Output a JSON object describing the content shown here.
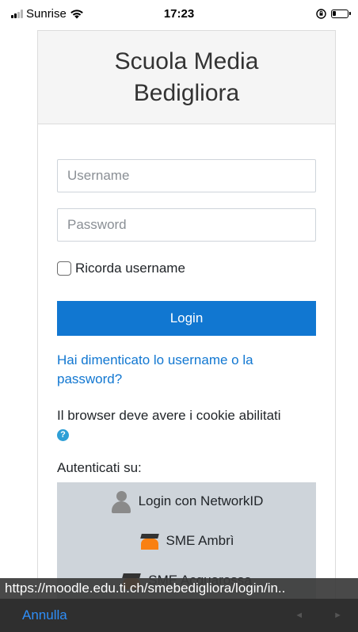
{
  "status_bar": {
    "carrier": "Sunrise",
    "time": "17:23"
  },
  "site": {
    "name": "Scuola Media Bedigliora"
  },
  "form": {
    "username_placeholder": "Username",
    "password_placeholder": "Password",
    "remember_label": "Ricorda username",
    "login_label": "Login",
    "forgot_link": "Hai dimenticato lo username o la password?",
    "cookie_notice": "Il browser deve avere i cookie abilitati",
    "auth_label": "Autenticati su:"
  },
  "auth_providers": [
    {
      "label": "Login con NetworkID",
      "icon": "user-icon"
    },
    {
      "label": "SME Ambrì",
      "icon": "moodle-icon"
    },
    {
      "label": "SME Acquarossa",
      "icon": "moodle-icon"
    }
  ],
  "link_preview": {
    "url": "https://moodle.edu.ti.ch/smebedigliora/login/in..",
    "cancel_label": "Annulla"
  }
}
